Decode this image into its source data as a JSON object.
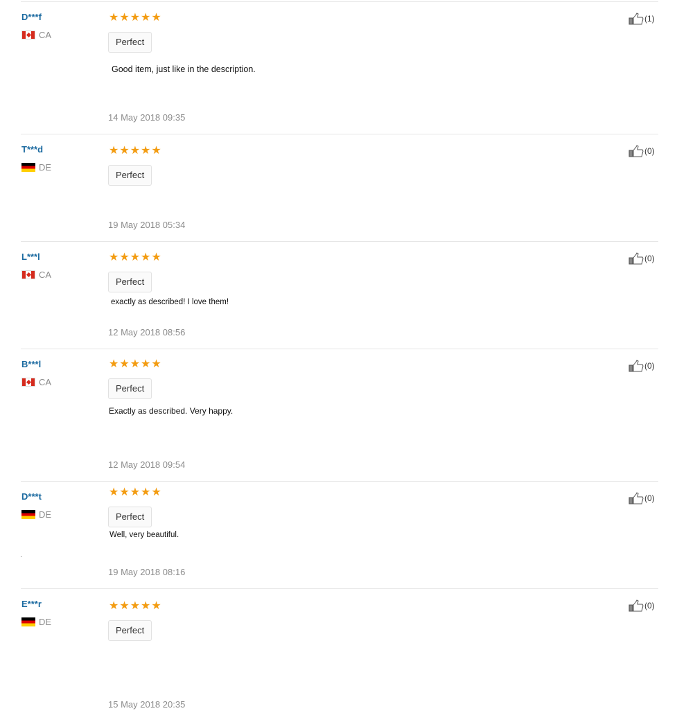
{
  "reviews": [
    {
      "user": "D***f",
      "country": "CA",
      "flag": "ca",
      "rating": 5,
      "tag": "Perfect",
      "text": "Good item, just like in the description.",
      "date": "14 May 2018 09:35",
      "helpful": "(1)"
    },
    {
      "user": "T***d",
      "country": "DE",
      "flag": "de",
      "rating": 5,
      "tag": "Perfect",
      "text": "",
      "date": "19 May 2018 05:34",
      "helpful": "(0)"
    },
    {
      "user": "L***l",
      "country": "CA",
      "flag": "ca",
      "rating": 5,
      "tag": "Perfect",
      "text": "exactly as described! I love them!",
      "date": "12 May 2018 08:56",
      "helpful": "(0)"
    },
    {
      "user": "B***l",
      "country": "CA",
      "flag": "ca",
      "rating": 5,
      "tag": "Perfect",
      "text": "Exactly as described. Very happy.",
      "date": "12 May 2018 09:54",
      "helpful": "(0)"
    },
    {
      "user": "D***t",
      "country": "DE",
      "flag": "de",
      "rating": 5,
      "tag": "Perfect",
      "text": "Well, very beautiful.",
      "date": "19 May 2018 08:16",
      "helpful": "(0)"
    },
    {
      "user": "E***r",
      "country": "DE",
      "flag": "de",
      "rating": 5,
      "tag": "Perfect",
      "text": "",
      "date": "15 May 2018 20:35",
      "helpful": "(0)"
    }
  ],
  "icons": {
    "star": "star-icon",
    "helpful": "thumbs-up-icon"
  },
  "colors": {
    "star": "#f39c12",
    "username": "#1b6aa0",
    "meta": "#8c8c8c"
  }
}
